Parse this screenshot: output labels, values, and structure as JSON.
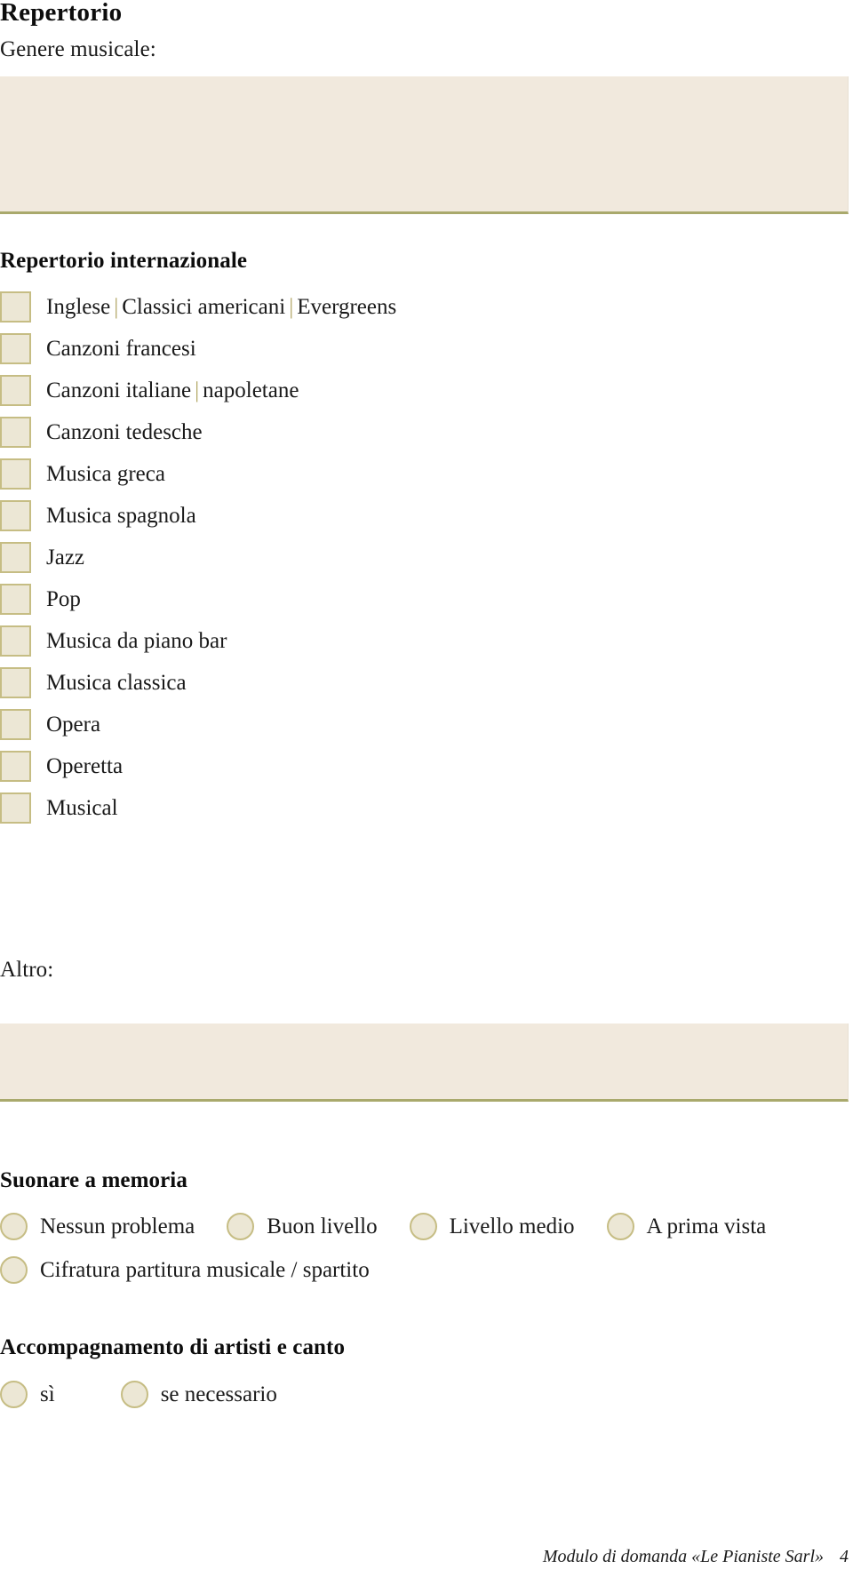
{
  "document": {
    "title": "Repertorio"
  },
  "genre": {
    "label": "Genere musicale:",
    "field_value": "",
    "field_placeholder": ""
  },
  "international": {
    "heading": "Repertorio internazionale",
    "items": [
      {
        "parts": [
          "Inglese",
          "Classici americani",
          "Evergreens"
        ],
        "checked": false
      },
      {
        "parts": [
          "Canzoni francesi"
        ],
        "checked": false
      },
      {
        "parts": [
          "Canzoni italiane",
          "napoletane"
        ],
        "checked": false
      },
      {
        "parts": [
          "Canzoni tedesche"
        ],
        "checked": false
      },
      {
        "parts": [
          "Musica greca"
        ],
        "checked": false
      },
      {
        "parts": [
          "Musica spagnola"
        ],
        "checked": false
      },
      {
        "parts": [
          "Jazz"
        ],
        "checked": false
      },
      {
        "parts": [
          "Pop"
        ],
        "checked": false
      },
      {
        "parts": [
          "Musica da piano bar"
        ],
        "checked": false
      },
      {
        "parts": [
          "Musica classica"
        ],
        "checked": false
      },
      {
        "parts": [
          "Opera"
        ],
        "checked": false
      },
      {
        "parts": [
          "Operetta"
        ],
        "checked": false
      },
      {
        "parts": [
          "Musical"
        ],
        "checked": false
      }
    ],
    "separator": "|"
  },
  "other": {
    "label": "Altro:",
    "field_value": "",
    "field_placeholder": ""
  },
  "memory": {
    "heading": "Suonare a memoria",
    "options_row1": [
      {
        "label": "Nessun problema",
        "selected": false
      },
      {
        "label": "Buon livello",
        "selected": false
      },
      {
        "label": "Livello medio",
        "selected": false
      },
      {
        "label": "A prima vista",
        "selected": false
      }
    ],
    "options_row2": [
      {
        "label": "Cifratura partitura musicale / spartito",
        "selected": false
      }
    ]
  },
  "accompaniment": {
    "heading": "Accompagnamento di artisti e canto",
    "options": [
      {
        "label": "sì",
        "selected": false
      },
      {
        "label": "se necessario",
        "selected": false
      }
    ]
  },
  "footer": {
    "text": "Modulo di domanda «Le Pianiste Sarl»",
    "page_number": "4"
  },
  "colors": {
    "field_bg": "#f1e9dd",
    "field_underline": "#a9a96c",
    "control_bg": "#ece7d5",
    "control_border": "#c6bd84",
    "separator": "#b3a867"
  }
}
